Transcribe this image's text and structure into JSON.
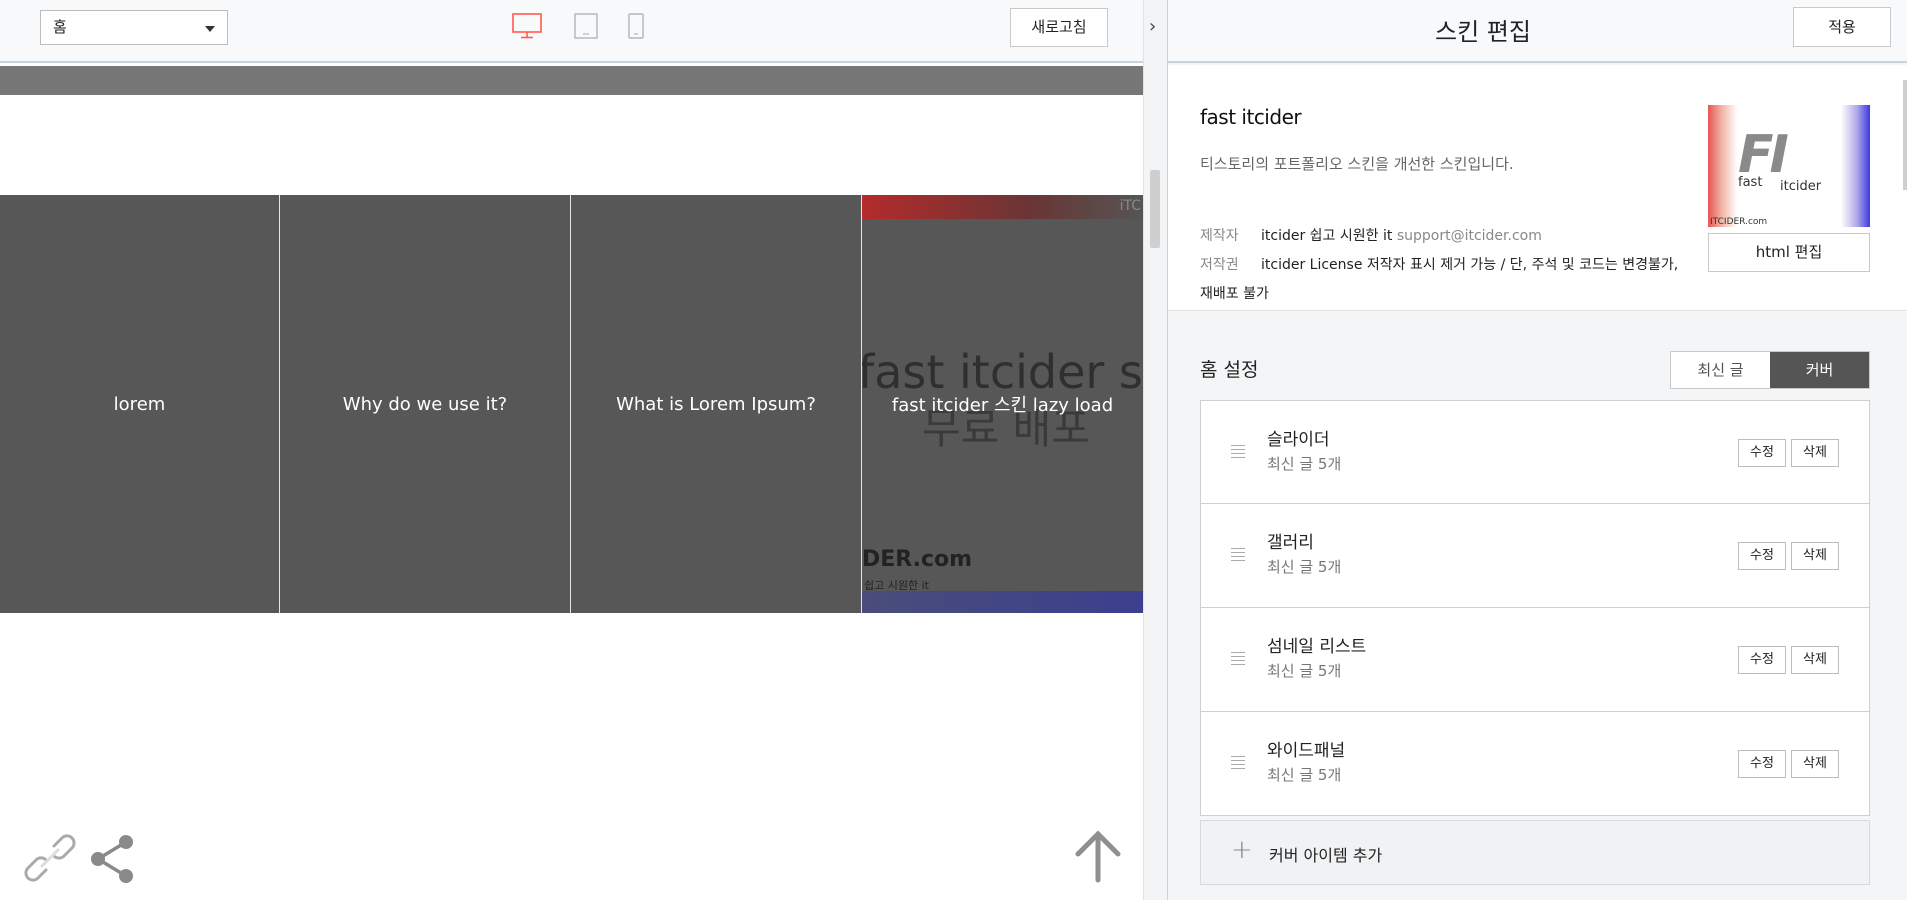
{
  "preview": {
    "page_select": "홈",
    "refresh_label": "새로고침",
    "devices": [
      "desktop-icon",
      "tablet-icon",
      "mobile-icon"
    ],
    "accent_color": "#ff5a4a",
    "cards": [
      {
        "title": "lorem"
      },
      {
        "title": "Why do we use it?"
      },
      {
        "title": "What is Lorem Ipsum?"
      },
      {
        "title": "fast itcider 스킨 lazy load",
        "image_text": {
          "corner": "iTC",
          "line1": "fast itcider skin",
          "line2": "무료 배포",
          "logo": "DER.com",
          "logo_sub": "쉽고 시원한 it"
        }
      }
    ]
  },
  "panel": {
    "title": "스킨 편집",
    "apply_label": "적용",
    "skin": {
      "name": "fast itcider",
      "description": "티스토리의 포트폴리오 스킨을 개선한 스킨입니다.",
      "author_label": "제작자",
      "author": "itcider 쉽고 시원한 it",
      "author_email": "support@itcider.com",
      "license_label": "저작권",
      "license_line1": "itcider License 저작자 표시 제거 가능 / 단, 주석 및 코드는 변경불가,",
      "license_line2": "재배포 불가",
      "thumb_logo": "FI",
      "thumb_word1": "fast",
      "thumb_word2": "itcider",
      "thumb_url": "ITCIDER.com",
      "html_edit_label": "html 편집"
    },
    "home": {
      "title": "홈 설정",
      "toggle": [
        "최신 글",
        "커버"
      ],
      "items": [
        {
          "name": "슬라이더",
          "sub": "최신 글 5개"
        },
        {
          "name": "갤러리",
          "sub": "최신 글 5개"
        },
        {
          "name": "섬네일 리스트",
          "sub": "최신 글 5개"
        },
        {
          "name": "와이드패널",
          "sub": "최신 글 5개"
        }
      ],
      "edit_label": "수정",
      "delete_label": "삭제",
      "add_label": "커버 아이템 추가"
    }
  }
}
